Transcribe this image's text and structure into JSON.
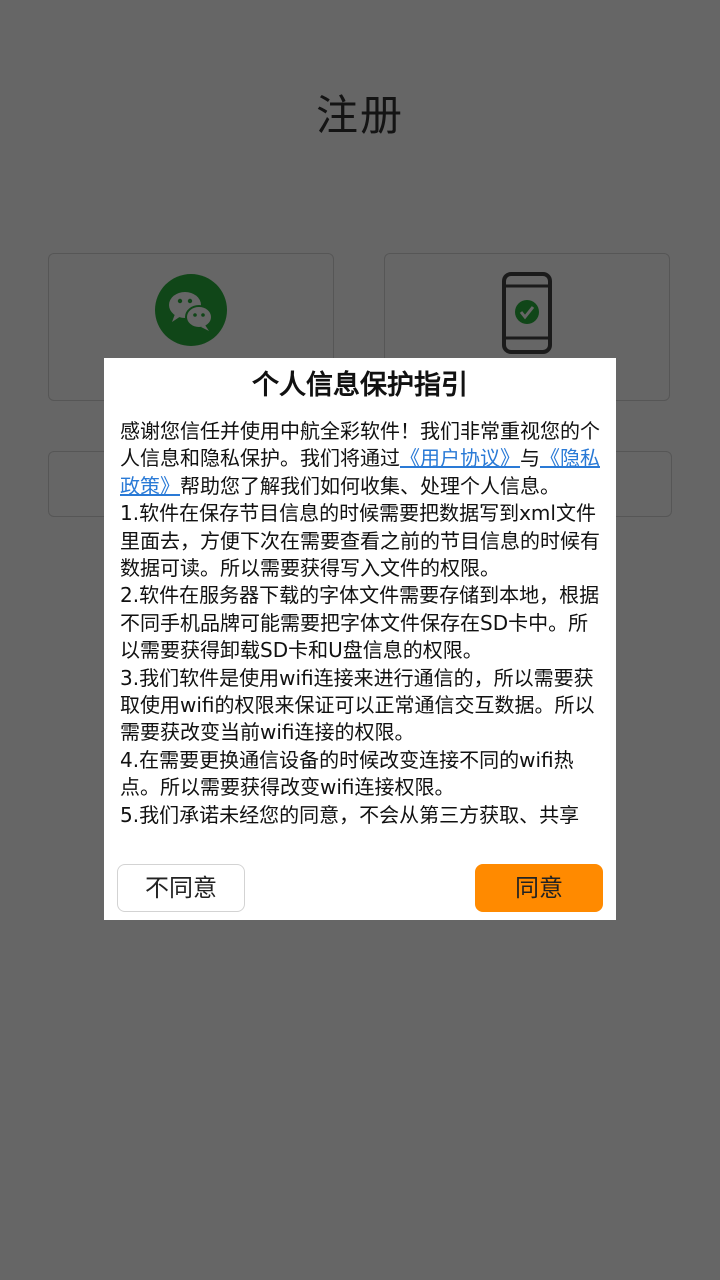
{
  "page": {
    "title": "注册"
  },
  "dialog": {
    "title": "个人信息保护指引",
    "intro_before": "感谢您信任并使用中航全彩软件！我们非常重视您的个人信息和隐私保护。我们将通过",
    "user_agreement_link": "《用户协议》",
    "intro_and": "与",
    "privacy_policy_link": "《隐私政策》",
    "intro_after": "帮助您了解我们如何收集、处理个人信息。",
    "items": [
      " 1.软件在保存节目信息的时候需要把数据写到xml文件里面去，方便下次在需要查看之前的节目信息的时候有数据可读。所以需要获得写入文件的权限。",
      " 2.软件在服务器下载的字体文件需要存储到本地，根据不同手机品牌可能需要把字体文件保存在SD卡中。所以需要获得卸载SD卡和U盘信息的权限。",
      " 3.我们软件是使用wifi连接来进行通信的，所以需要获取使用wifi的权限来保证可以正常通信交互数据。所以需要获改变当前wifi连接的权限。",
      " 4.在需要更换通信设备的时候改变连接不同的wifi热点。所以需要获得改变wifi连接权限。",
      " 5.我们承诺未经您的同意，不会从第三方获取、共享"
    ],
    "disagree_label": "不同意",
    "agree_label": "同意"
  },
  "colors": {
    "accent": "#ff8a00",
    "link": "#2a7ad6",
    "wechat_green": "#2aae3c",
    "check_green": "#2aae3c"
  },
  "icons": {
    "wechat": "wechat-icon",
    "phone": "phone-check-icon"
  }
}
